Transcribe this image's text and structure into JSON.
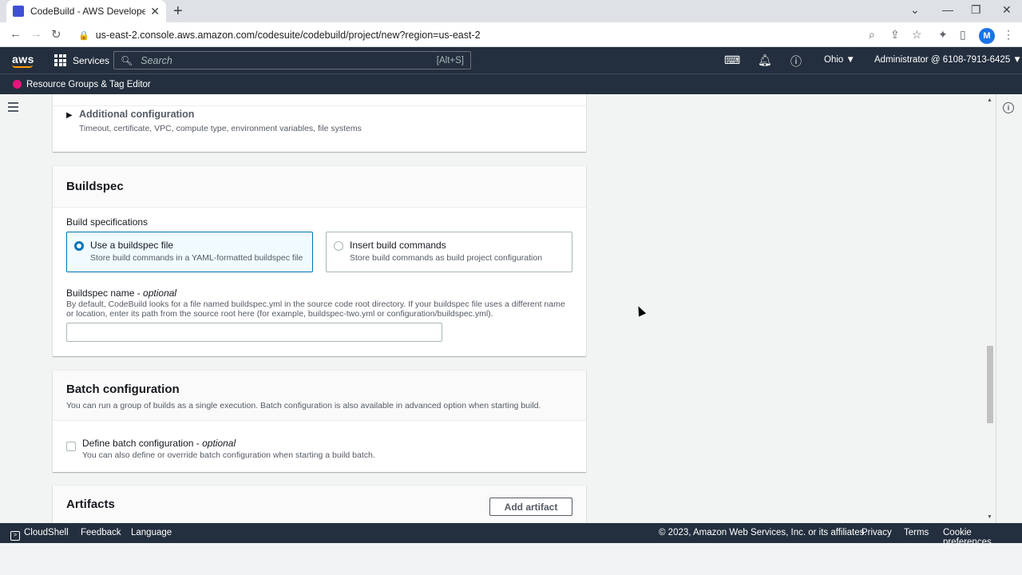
{
  "browser": {
    "tab_title": "CodeBuild - AWS Developer Tools",
    "url": "us-east-2.console.aws.amazon.com/codesuite/codebuild/project/new?region=us-east-2",
    "profile_initial": "M"
  },
  "aws_header": {
    "logo": "aws",
    "services_label": "Services",
    "search_placeholder": "Search",
    "search_shortcut": "[Alt+S]",
    "region": "Ohio ▼",
    "account": "Administrator @ 6108-7913-6425 ▼",
    "favorite": "Resource Groups & Tag Editor"
  },
  "additional_config": {
    "title": "Additional configuration",
    "description": "Timeout, certificate, VPC, compute type, environment variables, file systems"
  },
  "buildspec": {
    "title": "Buildspec",
    "specs_label": "Build specifications",
    "option_file_title": "Use a buildspec file",
    "option_file_desc": "Store build commands in a YAML-formatted buildspec file",
    "option_insert_title": "Insert build commands",
    "option_insert_desc": "Store build commands as build project configuration",
    "name_label": "Buildspec name - ",
    "name_optional": "optional",
    "name_desc": "By default, CodeBuild looks for a file named buildspec.yml in the source code root directory. If your buildspec file uses a different name or location, enter its path from the source root here (for example, buildspec-two.yml or configuration/buildspec.yml).",
    "name_value": ""
  },
  "batch": {
    "title": "Batch configuration",
    "description": "You can run a group of builds as a single execution. Batch configuration is also available in advanced option when starting build.",
    "define_label": "Define batch configuration - ",
    "define_optional": "optional",
    "define_desc": "You can also define or override batch configuration when starting a build batch."
  },
  "artifacts": {
    "title": "Artifacts",
    "add_button": "Add artifact"
  },
  "footer": {
    "cloudshell": "CloudShell",
    "feedback": "Feedback",
    "language": "Language",
    "copyright": "© 2023, Amazon Web Services, Inc. or its affiliates.",
    "privacy": "Privacy",
    "terms": "Terms",
    "cookies": "Cookie preferences"
  }
}
